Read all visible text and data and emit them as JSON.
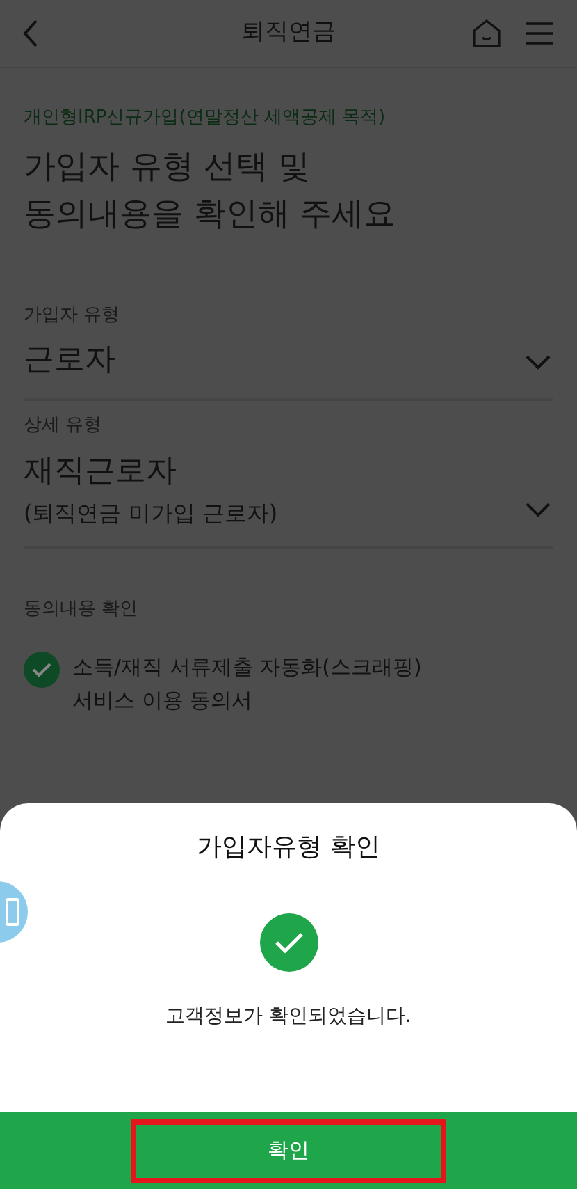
{
  "header": {
    "title": "퇴직연금"
  },
  "intro": {
    "subtitle": "개인형IRP신규가입(연말정산 세액공제 목적)",
    "heading_lines": [
      "가입자 유형 선택 및",
      "동의내용을 확인해 주세요"
    ]
  },
  "fields": [
    {
      "label": "가입자 유형",
      "value": "근로자"
    },
    {
      "label": "상세 유형",
      "value": "재직근로자",
      "note": "(퇴직연금 미가입 근로자)"
    }
  ],
  "consent": {
    "label": "동의내용 확인",
    "items": [
      {
        "text_lines": [
          "소득/재직 서류제출 자동화(스크래핑)",
          "서비스 이용 동의서"
        ],
        "checked": true
      }
    ]
  },
  "dialog": {
    "title": "가입자유형 확인",
    "message": "고객정보가 확인되었습니다.",
    "button": "확인",
    "highlighted": true
  }
}
